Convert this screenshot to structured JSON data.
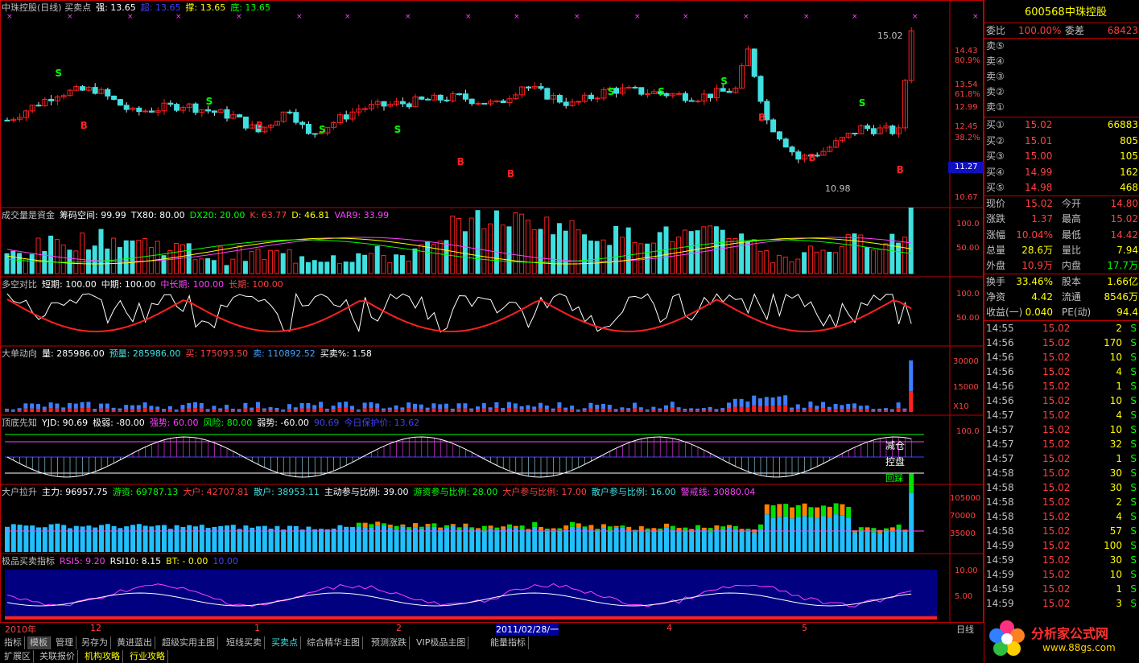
{
  "colors": {
    "up": "#ff2020",
    "down": "#40e0e0",
    "border": "#c00000",
    "axis": "#ff4040",
    "yellow": "#ffff00",
    "white": "#ffffff",
    "green": "#00ff00"
  },
  "panels": [
    {
      "title": "中珠控股(日线) 买卖点",
      "items": [
        {
          "text": "强: 13.65",
          "color": "#ffffff"
        },
        {
          "text": "超: 13.65",
          "color": "#4040ff"
        },
        {
          "text": "撑: 13.65",
          "color": "#ffff00"
        },
        {
          "text": "底: 13.65",
          "color": "#00ff00"
        }
      ]
    },
    {
      "title": "成交量是資金",
      "items": [
        {
          "text": "筹码空间: 99.99",
          "color": "#ffffff"
        },
        {
          "text": "TX80: 80.00",
          "color": "#ffffff"
        },
        {
          "text": "DX20: 20.00",
          "color": "#00ff00"
        },
        {
          "text": "K: 63.77",
          "color": "#ff4040"
        },
        {
          "text": "D: 46.81",
          "color": "#ffff00"
        },
        {
          "text": "VAR9: 33.99",
          "color": "#ff40ff"
        }
      ]
    },
    {
      "title": "多空对比",
      "items": [
        {
          "text": "短期: 100.00",
          "color": "#ffffff"
        },
        {
          "text": "中期: 100.00",
          "color": "#ffffff"
        },
        {
          "text": "中长期: 100.00",
          "color": "#ff40ff"
        },
        {
          "text": "长期: 100.00",
          "color": "#ff4040"
        }
      ]
    },
    {
      "title": "大单动向",
      "items": [
        {
          "text": "量: 285986.00",
          "color": "#ffffff"
        },
        {
          "text": "预量: 285986.00",
          "color": "#40e0e0"
        },
        {
          "text": "买: 175093.50",
          "color": "#ff4040"
        },
        {
          "text": "卖: 110892.52",
          "color": "#40a0ff"
        },
        {
          "text": "买卖%: 1.58",
          "color": "#ffffff"
        }
      ]
    },
    {
      "title": "顶底先知",
      "items": [
        {
          "text": "YJD: 90.69",
          "color": "#ffffff"
        },
        {
          "text": "极弱: -80.00",
          "color": "#ffffff"
        },
        {
          "text": "强势: 60.00",
          "color": "#ff40ff"
        },
        {
          "text": "风险: 80.00",
          "color": "#00ff00"
        },
        {
          "text": "弱势: -60.00",
          "color": "#ffffff"
        },
        {
          "text": "90.69",
          "color": "#4040ff"
        },
        {
          "text": "今日保护价: 13.62",
          "color": "#4040ff"
        }
      ]
    },
    {
      "title": "大户拉升",
      "items": [
        {
          "text": "主力: 96957.75",
          "color": "#ffffff"
        },
        {
          "text": "游资: 69787.13",
          "color": "#00ff00"
        },
        {
          "text": "大户: 42707.81",
          "color": "#ff4040"
        },
        {
          "text": "散户: 38953.11",
          "color": "#40e0e0"
        },
        {
          "text": "主动参与比例: 39.00",
          "color": "#ffffff"
        },
        {
          "text": "游资参与比例: 28.00",
          "color": "#00ff00"
        },
        {
          "text": "大户参与比例: 17.00",
          "color": "#ff4040"
        },
        {
          "text": "散户参与比例: 16.00",
          "color": "#40e0e0"
        },
        {
          "text": "警戒线: 30880.04",
          "color": "#ff40ff"
        }
      ]
    },
    {
      "title": "极品买卖指标",
      "items": [
        {
          "text": "RSI5: 9.20",
          "color": "#ff40ff"
        },
        {
          "text": "RSI10: 8.15",
          "color": "#ffffff"
        },
        {
          "text": "BT: - 0.00",
          "color": "#ffff00"
        },
        {
          "text": "10.00",
          "color": "#4040ff"
        }
      ]
    }
  ],
  "scales": {
    "price": [
      "14.43",
      "80.9%",
      "13.54",
      "61.8%",
      "12.99",
      "12.45",
      "38.2%",
      "11.27",
      "10.67"
    ],
    "vol": [
      "100.0",
      "50.00"
    ],
    "dk": [
      "100.0",
      "50.00"
    ],
    "big": [
      "30000",
      "15000",
      "X10"
    ],
    "dd": [
      "100.0"
    ],
    "dh": [
      "105000",
      "70000",
      "35000"
    ],
    "rsi": [
      "10.00",
      "5.00"
    ]
  },
  "annotations": {
    "high": "15.02",
    "low": "10.98",
    "reduce": "减仓",
    "control": "控盘",
    "huishou": "回踩"
  },
  "xaxis": [
    "2010年",
    "12",
    "1",
    "2",
    "2011/02/28/一",
    "4",
    "5"
  ],
  "period": "日线",
  "tabs_row1": [
    "指标",
    "模板",
    "管理",
    "另存为",
    "黄进蓝出",
    "超级实用主图",
    "短线买卖",
    "买卖点",
    "综合精华主图",
    "预测涨跌",
    "VIP极品主图",
    "能量指标"
  ],
  "tabs_row2": [
    "扩展区",
    "关联报价",
    "机构攻略",
    "行业攻略"
  ],
  "right": {
    "code": "600568",
    "name": "中珠控股",
    "weibi_label": "委比",
    "weibi": "100.00%",
    "weicha_label": "委差",
    "weicha": "68423",
    "sells": [
      {
        "label": "卖⑤",
        "price": "",
        "vol": ""
      },
      {
        "label": "卖④",
        "price": "",
        "vol": ""
      },
      {
        "label": "卖③",
        "price": "",
        "vol": ""
      },
      {
        "label": "卖②",
        "price": "",
        "vol": ""
      },
      {
        "label": "卖①",
        "price": "",
        "vol": ""
      }
    ],
    "buys": [
      {
        "label": "买①",
        "price": "15.02",
        "vol": "66883"
      },
      {
        "label": "买②",
        "price": "15.01",
        "vol": "805"
      },
      {
        "label": "买③",
        "price": "15.00",
        "vol": "105"
      },
      {
        "label": "买④",
        "price": "14.99",
        "vol": "162"
      },
      {
        "label": "买⑤",
        "price": "14.98",
        "vol": "468"
      }
    ],
    "quote": [
      {
        "l1": "现价",
        "v1": "15.02",
        "c1": "#ff4040",
        "l2": "今开",
        "v2": "14.80",
        "c2": "#ff4040"
      },
      {
        "l1": "涨跌",
        "v1": "1.37",
        "c1": "#ff4040",
        "l2": "最高",
        "v2": "15.02",
        "c2": "#ff4040"
      },
      {
        "l1": "涨幅",
        "v1": "10.04%",
        "c1": "#ff4040",
        "l2": "最低",
        "v2": "14.42",
        "c2": "#ff4040"
      },
      {
        "l1": "总量",
        "v1": "28.6万",
        "c1": "#ffff00",
        "l2": "量比",
        "v2": "7.94",
        "c2": "#ffff00"
      },
      {
        "l1": "外盘",
        "v1": "10.9万",
        "c1": "#ff4040",
        "l2": "内盘",
        "v2": "17.7万",
        "c2": "#00ff00"
      }
    ],
    "stats": [
      {
        "l1": "换手",
        "v1": "33.46%",
        "l2": "股本",
        "v2": "1.66亿"
      },
      {
        "l1": "净资",
        "v1": "4.42",
        "l2": "流通",
        "v2": "8546万"
      },
      {
        "l1": "收益(一)",
        "v1": "0.040",
        "l2": "PE(动)",
        "v2": "94.4"
      }
    ],
    "ticks": [
      {
        "t": "14:55",
        "p": "15.02",
        "v": "2",
        "f": "S"
      },
      {
        "t": "14:56",
        "p": "15.02",
        "v": "170",
        "f": "S"
      },
      {
        "t": "14:56",
        "p": "15.02",
        "v": "10",
        "f": "S"
      },
      {
        "t": "14:56",
        "p": "15.02",
        "v": "4",
        "f": "S"
      },
      {
        "t": "14:56",
        "p": "15.02",
        "v": "1",
        "f": "S"
      },
      {
        "t": "14:56",
        "p": "15.02",
        "v": "10",
        "f": "S"
      },
      {
        "t": "14:57",
        "p": "15.02",
        "v": "4",
        "f": "S"
      },
      {
        "t": "14:57",
        "p": "15.02",
        "v": "10",
        "f": "S"
      },
      {
        "t": "14:57",
        "p": "15.02",
        "v": "32",
        "f": "S"
      },
      {
        "t": "14:57",
        "p": "15.02",
        "v": "1",
        "f": "S"
      },
      {
        "t": "14:58",
        "p": "15.02",
        "v": "30",
        "f": "S"
      },
      {
        "t": "14:58",
        "p": "15.02",
        "v": "30",
        "f": "S"
      },
      {
        "t": "14:58",
        "p": "15.02",
        "v": "2",
        "f": "S"
      },
      {
        "t": "14:58",
        "p": "15.02",
        "v": "4",
        "f": "S"
      },
      {
        "t": "14:58",
        "p": "15.02",
        "v": "57",
        "f": "S"
      },
      {
        "t": "14:59",
        "p": "15.02",
        "v": "100",
        "f": "S"
      },
      {
        "t": "14:59",
        "p": "15.02",
        "v": "30",
        "f": "S"
      },
      {
        "t": "14:59",
        "p": "15.02",
        "v": "10",
        "f": "S"
      },
      {
        "t": "14:59",
        "p": "15.02",
        "v": "1",
        "f": "S"
      },
      {
        "t": "14:59",
        "p": "15.02",
        "v": "3",
        "f": "S"
      }
    ]
  },
  "watermark": {
    "name": "分析家公式网",
    "url": "www.88gs.com"
  }
}
